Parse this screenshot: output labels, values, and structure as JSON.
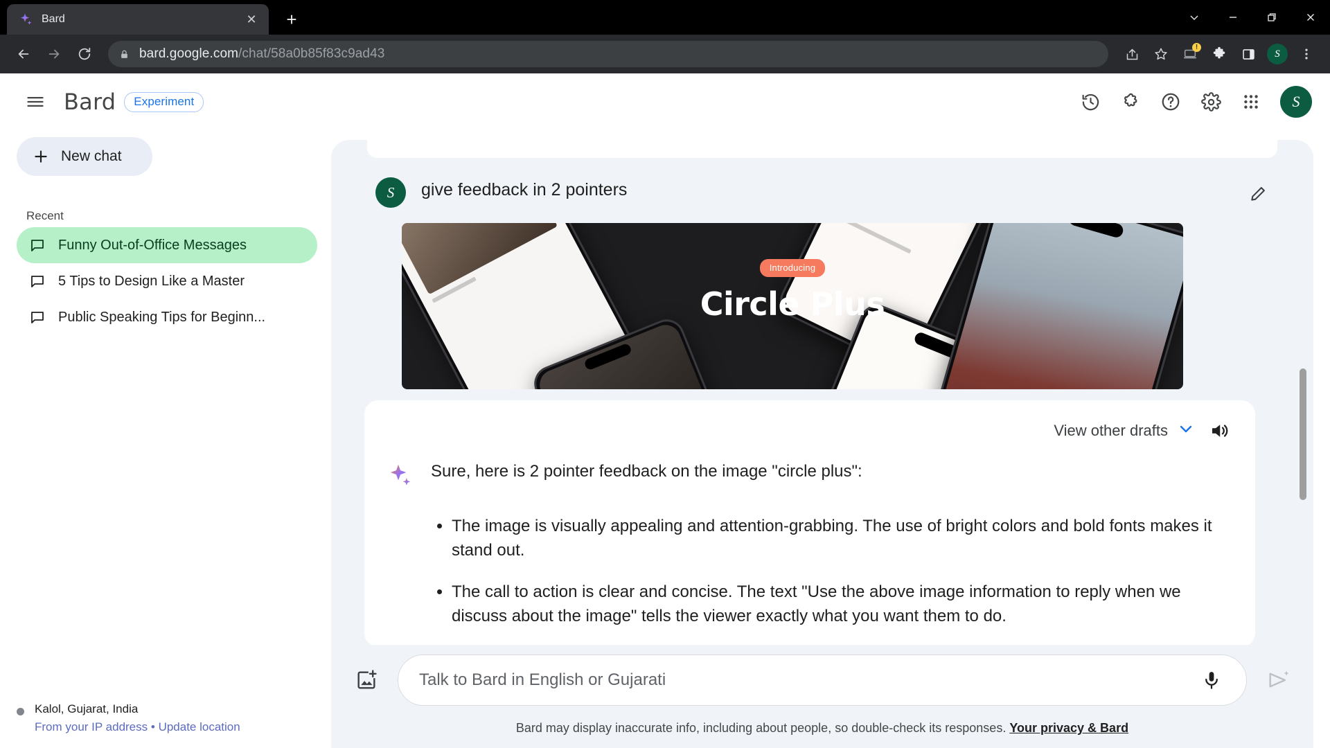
{
  "browser": {
    "tab": {
      "title": "Bard",
      "favicon_icon": "bard-sparkle-icon",
      "close_icon": "close-icon"
    },
    "new_tab_icon": "plus-icon",
    "window_controls": [
      {
        "name": "tab-search",
        "glyph": "⌄"
      },
      {
        "name": "minimize",
        "glyph": "—"
      },
      {
        "name": "maximize",
        "glyph": "❐"
      },
      {
        "name": "close",
        "glyph": "✕"
      }
    ],
    "nav": {
      "back_icon": "back-arrow-icon",
      "forward_icon": "forward-arrow-icon",
      "reload_icon": "reload-icon"
    },
    "omnibox": {
      "lock_icon": "lock-icon",
      "domain": "bard.google.com",
      "path": "/chat/58a0b85f83c9ad43"
    },
    "toolbar_right": [
      {
        "name": "share-icon"
      },
      {
        "name": "bookmark-star-icon"
      },
      {
        "name": "update-available-icon",
        "badge": "!"
      },
      {
        "name": "extensions-puzzle-icon"
      },
      {
        "name": "side-panel-icon"
      },
      {
        "name": "profile-avatar",
        "initial": "S"
      },
      {
        "name": "chrome-menu-icon"
      }
    ]
  },
  "app": {
    "header": {
      "menu_icon": "hamburger-menu-icon",
      "title": "Bard",
      "badge": "Experiment",
      "icons": [
        {
          "name": "history-icon"
        },
        {
          "name": "extensions-icon"
        },
        {
          "name": "help-icon"
        },
        {
          "name": "settings-gear-icon"
        },
        {
          "name": "google-apps-grid-icon"
        }
      ],
      "avatar_initial": "S"
    },
    "sidebar": {
      "new_chat_label": "New chat",
      "new_chat_icon": "plus-icon",
      "recent_label": "Recent",
      "chats": [
        {
          "label": "Funny Out-of-Office Messages",
          "active": true
        },
        {
          "label": "5 Tips to Design Like a Master",
          "active": false
        },
        {
          "label": "Public Speaking Tips for Beginn...",
          "active": false
        }
      ],
      "location": "Kalol, Gujarat, India",
      "location_source": "From your IP address",
      "location_separator": "•",
      "location_update": "Update location"
    },
    "conversation": {
      "user_avatar_initial": "S",
      "prompt": "give feedback in 2 pointers",
      "edit_icon": "edit-pencil-icon",
      "attachment": {
        "alt": "Circle Plus promotional banner with phone mockups",
        "intro_label": "Introducing",
        "title": "Circle Plus",
        "accent_color": "#f57a5e",
        "background_color": "#1d1d1f"
      },
      "drafts_label": "View other drafts",
      "drafts_chevron_icon": "chevron-down-icon",
      "speaker_icon": "speaker-icon",
      "bard_icon": "bard-sparkle-icon",
      "response_intro": "Sure, here is 2 pointer feedback on the image \"circle plus\":",
      "response_bullets": [
        "The image is visually appealing and attention-grabbing. The use of bright colors and bold fonts makes it stand out.",
        "The call to action is clear and concise. The text \"Use the above image information to reply when we discuss about the image\" tells the viewer exactly what you want them to do."
      ]
    },
    "composer": {
      "upload_icon": "image-upload-icon",
      "placeholder": "Talk to Bard in English or Gujarati",
      "value": "",
      "mic_icon": "microphone-icon",
      "send_icon": "send-icon"
    },
    "footer": {
      "disclaimer": "Bard may display inaccurate info, including about people, so double-check its responses.",
      "privacy_link": "Your privacy & Bard"
    }
  }
}
